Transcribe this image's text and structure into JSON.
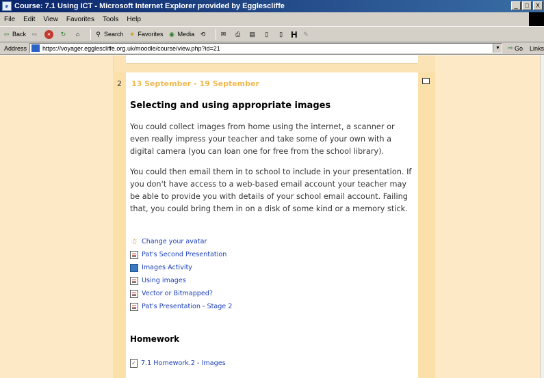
{
  "window": {
    "title": "Course: 7.1 Using ICT - Microsoft Internet Explorer provided by Egglescliffe",
    "controls": [
      "_",
      "□",
      "X"
    ]
  },
  "menu": [
    "File",
    "Edit",
    "View",
    "Favorites",
    "Tools",
    "Help"
  ],
  "toolbar": {
    "back": "Back",
    "search": "Search",
    "favorites": "Favorites",
    "media": "Media"
  },
  "address": {
    "label": "Address",
    "url": "https://voyager.egglescliffe.org.uk/moodle/course/view.php?id=21",
    "go": "Go",
    "links": "Links"
  },
  "section": {
    "number": "2",
    "dates": "13 September - 19 September",
    "heading": "Selecting and using appropriate images",
    "paragraph1": "You could collect images from home using the internet, a scanner or even really impress your teacher and take some of your own with a digital camera (you can loan one for free from the school library).",
    "paragraph2": "You could then email them in to school to include in your presentation. If you don't have access to a web-based email account your teacher may be able to provide you with details of your school email account. Failing that, you could bring them in on a disk of some kind or a memory stick.",
    "resources": [
      {
        "label": "Change your avatar",
        "icon": "avatar-icon"
      },
      {
        "label": "Pat's Second Presentation",
        "icon": "resource-doc-icon"
      },
      {
        "label": "Images Activity",
        "icon": "activity-icon"
      },
      {
        "label": "Using images",
        "icon": "resource-doc-icon"
      },
      {
        "label": "Vector or Bitmapped?",
        "icon": "resource-doc-icon"
      },
      {
        "label": "Pat's Presentation - Stage 2",
        "icon": "resource-doc-icon"
      }
    ],
    "homework": {
      "heading": "Homework",
      "item": "7.1 Homework.2 - Images"
    }
  },
  "colors": {
    "page_background": "#fde9c6",
    "section_border": "#fbe0aa",
    "dates": "#f0b84f",
    "link": "#1a3fb8"
  }
}
